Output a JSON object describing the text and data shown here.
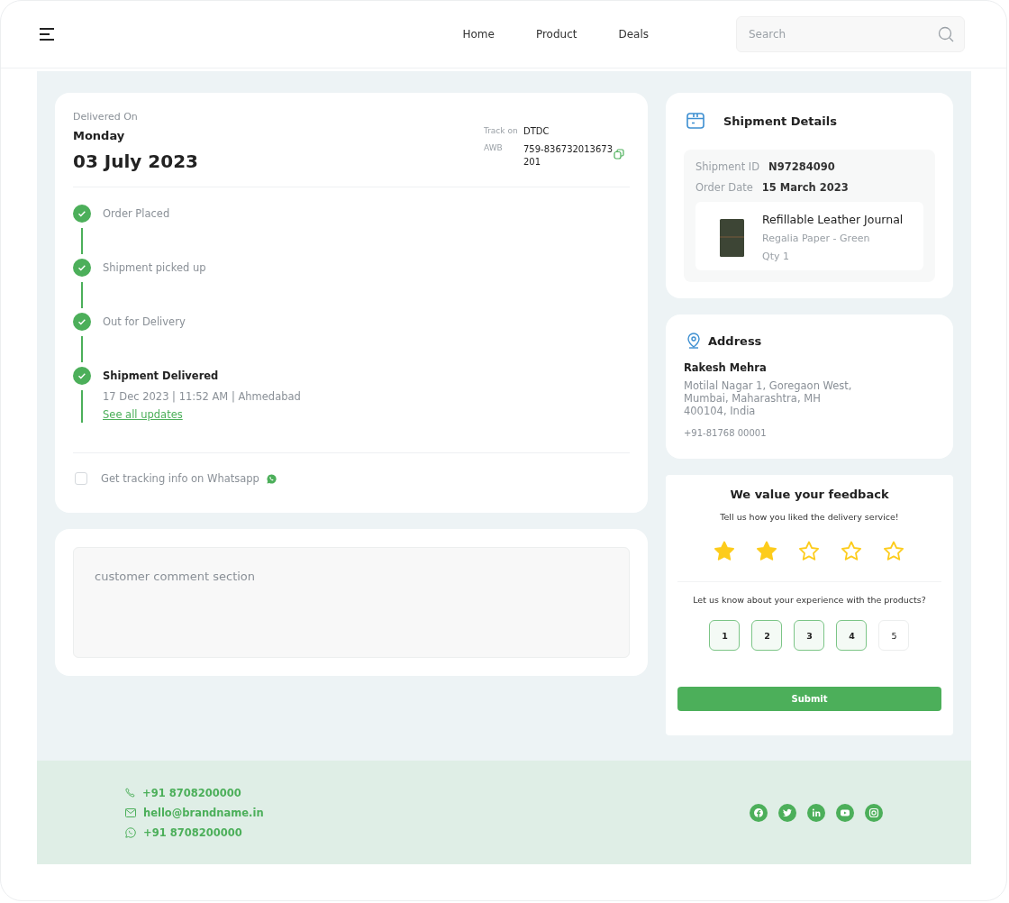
{
  "header": {
    "nav": [
      {
        "label": "Home"
      },
      {
        "label": "Product"
      },
      {
        "label": "Deals"
      }
    ],
    "search": {
      "placeholder": "Search"
    }
  },
  "delivery": {
    "label": "Delivered On",
    "day": "Monday",
    "date": "03 July 2023",
    "track_label": "Track on",
    "carrier": "DTDC",
    "awb_label": "AWB",
    "awb": "759-836732013673201"
  },
  "timeline": [
    {
      "label": "Order Placed",
      "done": true,
      "current": false
    },
    {
      "label": "Shipment picked up",
      "done": true,
      "current": false
    },
    {
      "label": "Out for Delivery",
      "done": true,
      "current": false
    },
    {
      "label": "Shipment Delivered",
      "done": true,
      "current": true,
      "detail": "17 Dec 2023 | 11:52 AM | Ahmedabad",
      "link": "See all updates"
    }
  ],
  "whatsapp": {
    "label": "Get tracking info on Whatsapp",
    "checked": false
  },
  "comment": {
    "placeholder": "customer comment section"
  },
  "shipment": {
    "title": "Shipment Details",
    "fields": [
      {
        "label": "Shipment ID",
        "value": "N97284090"
      },
      {
        "label": "Order Date",
        "value": "15 March 2023"
      }
    ],
    "product": {
      "name": "Refillable Leather Journal",
      "variant": "Regalia Paper - Green",
      "qty": "Qty 1"
    }
  },
  "address": {
    "title": "Address",
    "name": "Rakesh Mehra",
    "lines": [
      "Motilal Nagar 1, Goregaon West,",
      "Mumbai, Maharashtra, MH",
      "400104, India"
    ],
    "phone": "+91-81768 00001"
  },
  "feedback": {
    "title": "We value your feedback",
    "prompt": "Tell us how you liked the delivery service!",
    "stars": 2,
    "question": "Let us know about your experience with the products?",
    "ratings": [
      {
        "label": "1",
        "selected": true
      },
      {
        "label": "2",
        "selected": true
      },
      {
        "label": "3",
        "selected": true
      },
      {
        "label": "4",
        "selected": true
      },
      {
        "label": "5",
        "selected": false
      }
    ],
    "submit": "Submit"
  },
  "footer": {
    "contacts": [
      {
        "kind": "phone",
        "text": "+91 8708200000"
      },
      {
        "kind": "email",
        "text": "hello@brandname.in"
      },
      {
        "kind": "whatsapp",
        "text": "+91 8708200000"
      }
    ],
    "socials": [
      {
        "kind": "facebook"
      },
      {
        "kind": "twitter"
      },
      {
        "kind": "linkedin"
      },
      {
        "kind": "youtube"
      },
      {
        "kind": "instagram"
      }
    ]
  }
}
